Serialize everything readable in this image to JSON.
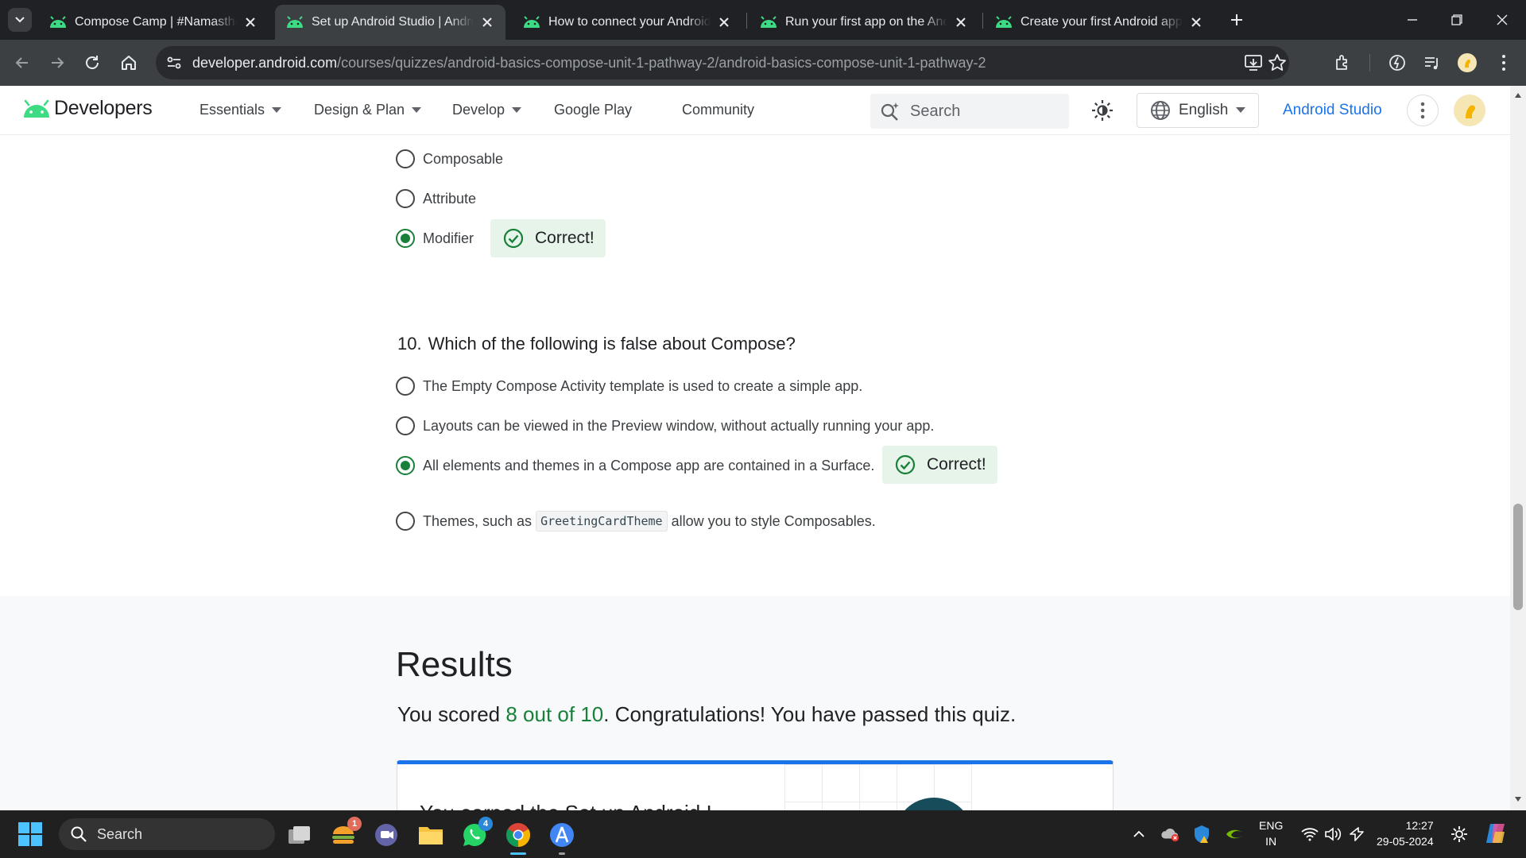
{
  "browser": {
    "tabs": [
      {
        "title": "Compose Camp | #NamastheAndroid",
        "active": false
      },
      {
        "title": "Set up Android Studio | Android Developers",
        "active": true
      },
      {
        "title": "How to connect your Android device",
        "active": false
      },
      {
        "title": "Run your first app on the Android Emulator",
        "active": false
      },
      {
        "title": "Create your first Android app",
        "active": false
      }
    ],
    "url_host": "developer.android.com",
    "url_path": "/courses/quizzes/android-basics-compose-unit-1-pathway-2/android-basics-compose-unit-1-pathway-2"
  },
  "site_header": {
    "logo_text": "Developers",
    "nav": [
      "Essentials",
      "Design & Plan",
      "Develop",
      "Google Play",
      "Community"
    ],
    "search_placeholder": "Search",
    "language": "English",
    "studio_link": "Android Studio"
  },
  "quiz": {
    "prev_question_options": [
      {
        "text": "Composable",
        "selected": false
      },
      {
        "text": "Attribute",
        "selected": false
      },
      {
        "text": "Modifier",
        "selected": true
      }
    ],
    "prev_feedback": "Correct!",
    "question_number": "10.",
    "question_text": "Which of the following is false about Compose?",
    "options": [
      {
        "text": "The Empty Compose Activity template is used to create a simple app.",
        "selected": false
      },
      {
        "text": "Layouts can be viewed in the Preview window, without actually running your app.",
        "selected": false
      },
      {
        "text": "All elements and themes in a Compose app are contained in a Surface.",
        "selected": true
      },
      {
        "text_before": "Themes, such as",
        "code": "GreetingCardTheme",
        "text_after": "allow you to style Composables.",
        "selected": false
      }
    ],
    "feedback": "Correct!"
  },
  "results": {
    "title": "Results",
    "line_prefix": "You scored",
    "score": "8 out of 10",
    "line_suffix": ". Congratulations! You have passed this quiz.",
    "card_partial_text": "You earned the Set up Android I"
  },
  "taskbar": {
    "search_label": "Search",
    "badges": {
      "widgets": "1",
      "whatsapp": "4"
    },
    "language_line1": "ENG",
    "language_line2": "IN",
    "time": "12:27",
    "date": "29-05-2024"
  },
  "colors": {
    "accent_green": "#188038",
    "link_blue": "#1a73e8",
    "android_green": "#3ddc84"
  }
}
